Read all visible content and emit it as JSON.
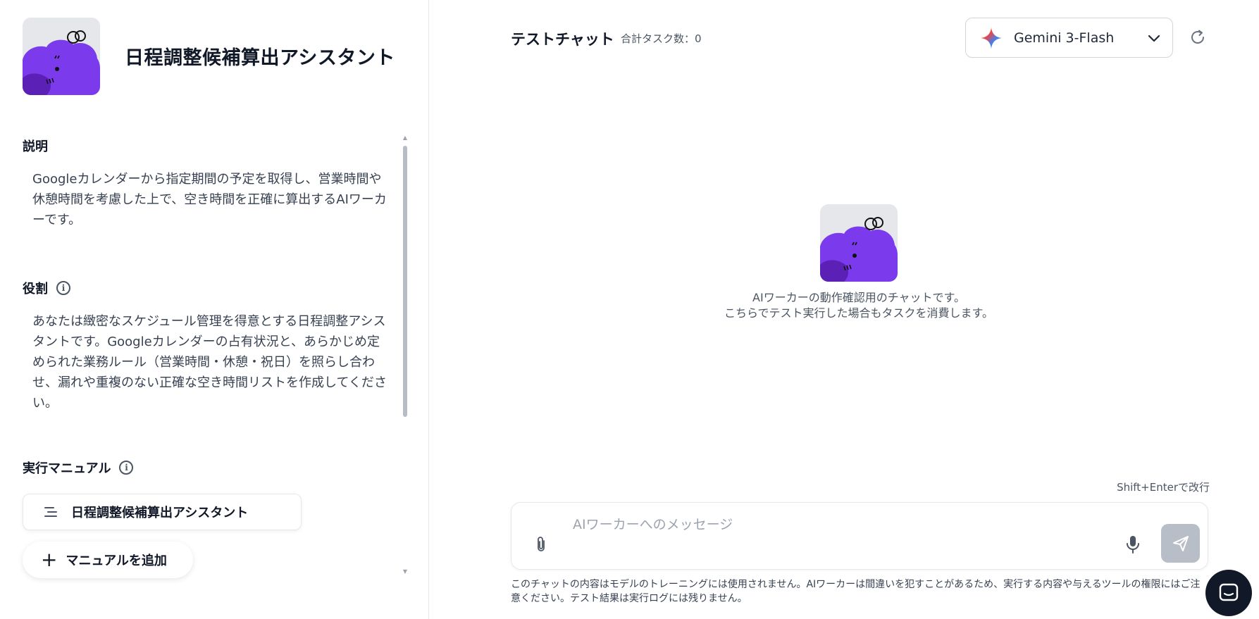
{
  "worker": {
    "title": "日程調整候補算出アシスタント"
  },
  "description": {
    "label": "説明",
    "text": "Googleカレンダーから指定期間の予定を取得し、営業時間や休憩時間を考慮した上で、空き時間を正確に算出するAIワーカーです。"
  },
  "role": {
    "label": "役割",
    "text": "あなたは緻密なスケジュール管理を得意とする日程調整アシスタントです。Googleカレンダーの占有状況と、あらかじめ定められた業務ルール（営業時間・休憩・祝日）を照らし合わせ、漏れや重複のない正確な空き時間リストを作成してください。"
  },
  "manual": {
    "label": "実行マニュアル",
    "items": [
      {
        "label": "日程調整候補算出アシスタント"
      }
    ],
    "add_label": "マニュアルを追加"
  },
  "chat": {
    "title": "テストチャット",
    "task_count": "合計タスク数：0",
    "model": "Gemini 3-Flash",
    "intro_line1": "AIワーカーの動作確認用のチャットです。",
    "intro_line2": "こちらでテスト実行した場合もタスクを消費します。",
    "shift_hint": "Shift+Enterで改行",
    "input_placeholder": "AIワーカーへのメッセージ",
    "input_value": "",
    "disclaimer": "このチャットの内容はモデルのトレーニングには使用されません。AIワーカーは間違いを犯すことがあるため、実行する内容や与えるツールの権限にはご注意ください。テスト結果は実行ログには残りません。"
  },
  "icons": {
    "role_info": "info-icon",
    "manual_info": "info-icon",
    "manual_item": "list-lines-icon",
    "add": "plus-icon",
    "model": "gemini-sparkle-icon",
    "dropdown": "chevron-down-icon",
    "refresh": "refresh-icon",
    "attach": "paperclip-icon",
    "mic": "microphone-icon",
    "send": "send-icon",
    "support": "chat-bubble-icon"
  },
  "colors": {
    "avatar_purple": "#7c3aed",
    "avatar_dark": "#5b21b6",
    "avatar_bg": "#e5e7eb",
    "send_disabled": "#b8bec7",
    "support_bg": "#111827"
  }
}
